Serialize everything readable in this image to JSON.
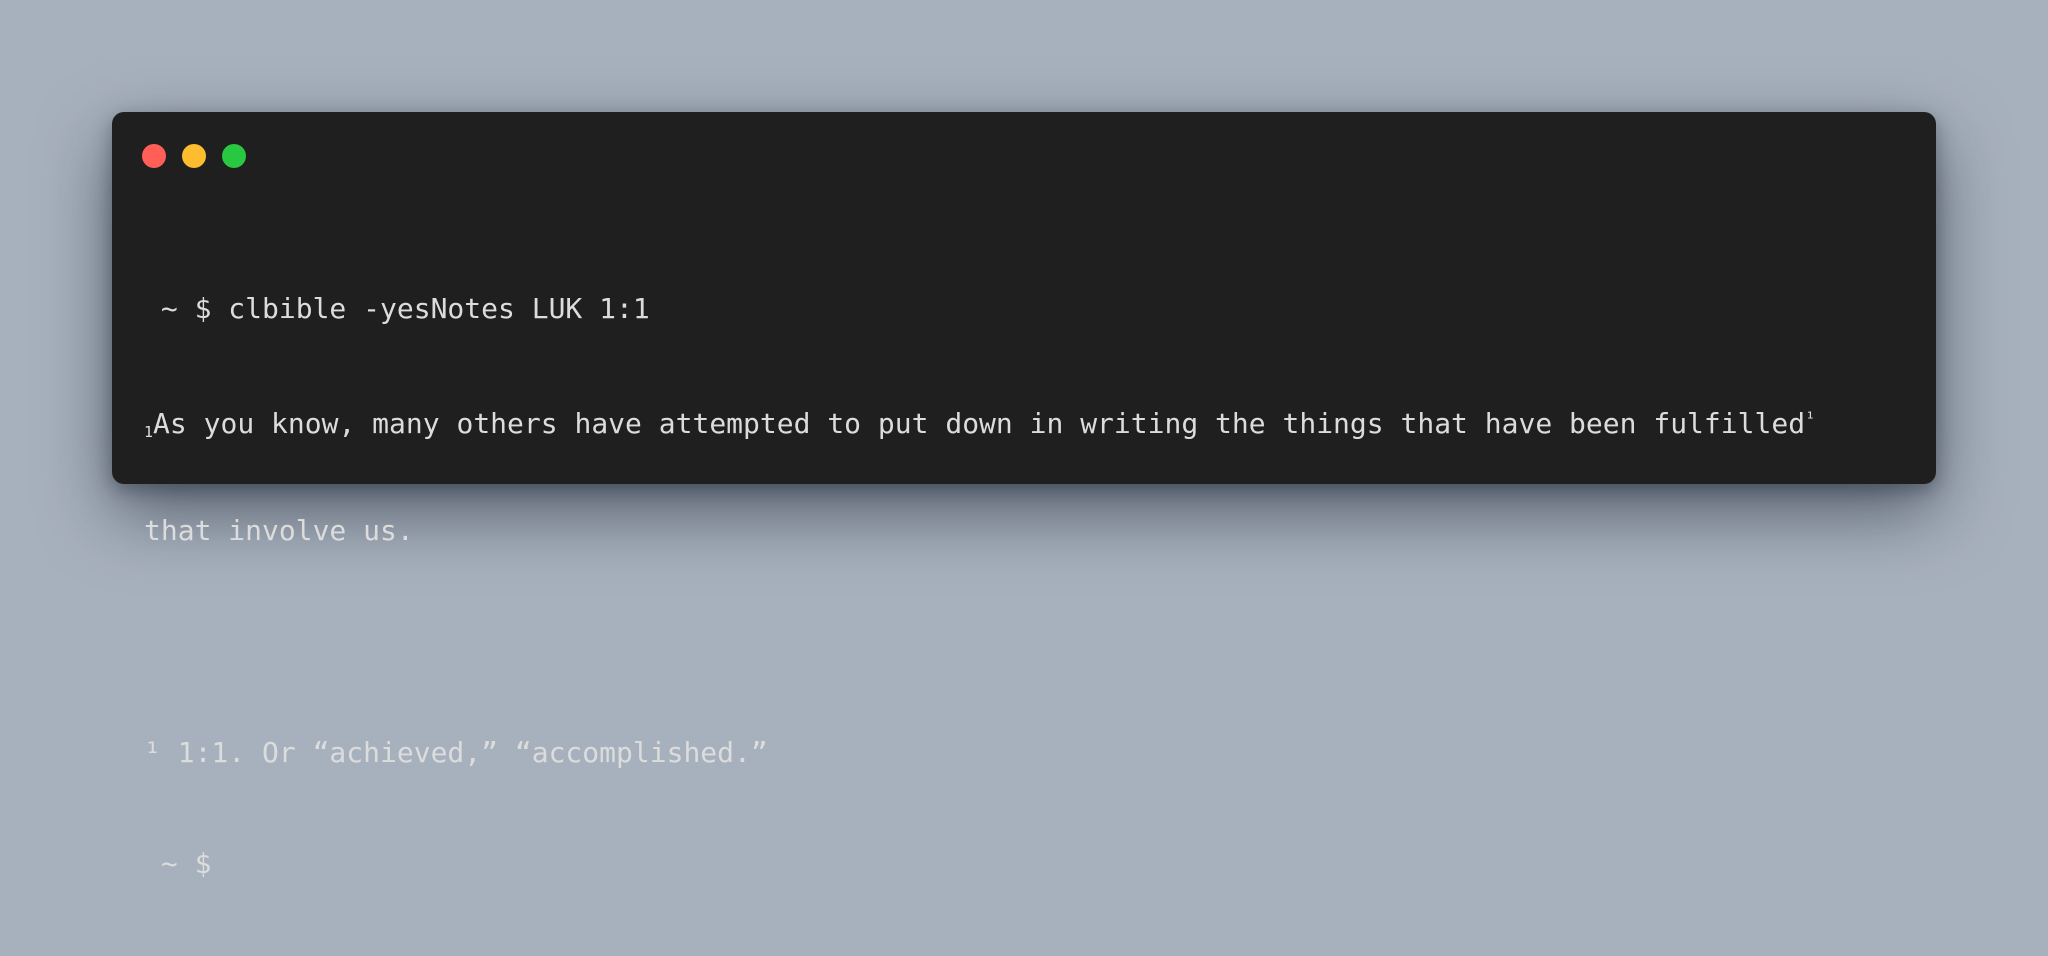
{
  "window": {
    "controls": [
      "close",
      "minimize",
      "maximize"
    ],
    "colors": {
      "close": "#ff5f57",
      "minimize": "#febc2e",
      "maximize": "#28c840",
      "background": "#1f1f1f",
      "text": "#dcdcdc"
    }
  },
  "terminal": {
    "command_line": " ~ $ clbible -yesNotes LUK 1:1",
    "verse_number": "1",
    "verse_text": "As you know, many others have attempted to put down in writing the things that have been fulfilled",
    "verse_footnote_marker": "¹",
    "verse_continuation": "that involve us.",
    "footnote_line": "¹ 1:1. Or “achieved,” “accomplished.”",
    "prompt_line": " ~ $"
  }
}
